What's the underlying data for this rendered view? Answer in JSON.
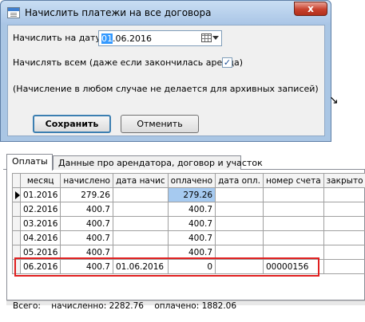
{
  "dialog": {
    "title": "Начислить платежи на все договора",
    "date_label": "Начислить на дату",
    "date_value_selected": "01",
    "date_value_rest": ".06.2016",
    "charge_all_label": "Начислять всем (даже если закончилась аренда)",
    "charge_all_checked": "✓",
    "note": "(Начисление в любом случае не делается для архивных записей)",
    "save_label": "Сохранить",
    "cancel_label": "Отменить",
    "close_label": "x"
  },
  "tabs": [
    {
      "label": "Оплаты"
    },
    {
      "label": "Данные про арендатора, договор и участок"
    }
  ],
  "grid": {
    "columns": [
      "месяц",
      "начислено",
      "дата начис",
      "оплачено",
      "дата опл.",
      "номер счета",
      "закрыто"
    ],
    "rows": [
      {
        "month": "01.2016",
        "charged": "279.26",
        "charge_date": "",
        "paid": "279.26",
        "pay_date": "",
        "invoice": "",
        "closed": ""
      },
      {
        "month": "02.2016",
        "charged": "400.7",
        "charge_date": "",
        "paid": "400.7",
        "pay_date": "",
        "invoice": "",
        "closed": ""
      },
      {
        "month": "03.2016",
        "charged": "400.7",
        "charge_date": "",
        "paid": "400.7",
        "pay_date": "",
        "invoice": "",
        "closed": ""
      },
      {
        "month": "04.2016",
        "charged": "400.7",
        "charge_date": "",
        "paid": "400.7",
        "pay_date": "",
        "invoice": "",
        "closed": ""
      },
      {
        "month": "05.2016",
        "charged": "400.7",
        "charge_date": "",
        "paid": "400.7",
        "pay_date": "",
        "invoice": "",
        "closed": ""
      },
      {
        "month": "06.2016",
        "charged": "400.7",
        "charge_date": "01.06.2016",
        "paid": "0",
        "pay_date": "",
        "invoice": "00000156",
        "closed": ""
      }
    ]
  },
  "totals": {
    "total": "Всего:",
    "charged": "начисленно: 2282.76",
    "paid": "оплачено: 1882.06"
  },
  "colors": {
    "highlight": "#e02020",
    "selected_cell": "#a6caf0",
    "title_bar": "#aac6e4"
  }
}
